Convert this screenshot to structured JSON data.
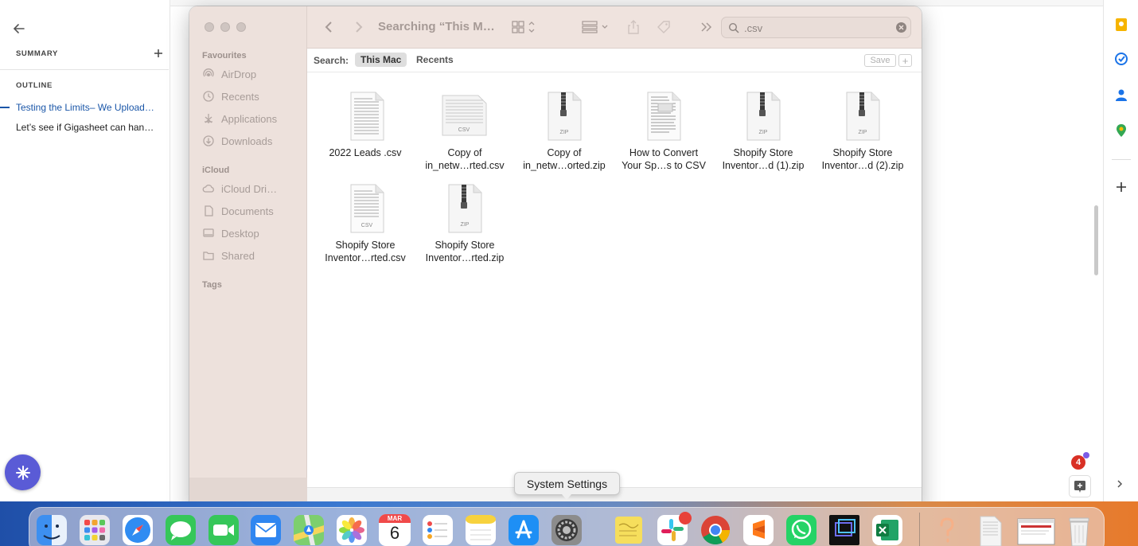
{
  "docs_outline": {
    "summary_label": "SUMMARY",
    "outline_label": "OUTLINE",
    "items": [
      {
        "label": "Testing the Limits– We Upload…",
        "active": true
      },
      {
        "label": "Let’s see if Gigasheet can han…",
        "active": false
      }
    ]
  },
  "finder": {
    "title": "Searching “This M…",
    "search": {
      "value": ".csv"
    },
    "scope": {
      "label": "Search:",
      "options": [
        "This Mac",
        "Recents"
      ],
      "selected": "This Mac",
      "save_label": "Save",
      "add_label": "+"
    },
    "sidebar": {
      "favourites_label": "Favourites",
      "favourites": [
        {
          "label": "AirDrop",
          "icon": "airdrop-icon"
        },
        {
          "label": "Recents",
          "icon": "clock-icon"
        },
        {
          "label": "Applications",
          "icon": "applications-icon"
        },
        {
          "label": "Downloads",
          "icon": "download-icon"
        }
      ],
      "icloud_label": "iCloud",
      "icloud": [
        {
          "label": "iCloud Dri…",
          "icon": "cloud-icon"
        },
        {
          "label": "Documents",
          "icon": "document-icon"
        },
        {
          "label": "Desktop",
          "icon": "desktop-icon"
        },
        {
          "label": "Shared",
          "icon": "shared-folder-icon"
        }
      ],
      "tags_label": "Tags"
    },
    "files": [
      {
        "line1": "2022 Leads .csv",
        "line2": "",
        "type": "csv"
      },
      {
        "line1": "Copy of",
        "line2": "in_netw…rted.csv",
        "type": "csv"
      },
      {
        "line1": "Copy of",
        "line2": "in_netw…orted.zip",
        "type": "zip"
      },
      {
        "line1": "How to Convert",
        "line2": "Your Sp…s to CSV",
        "type": "doc"
      },
      {
        "line1": "Shopify Store",
        "line2": "Inventor…d (1).zip",
        "type": "zip"
      },
      {
        "line1": "Shopify Store",
        "line2": "Inventor…d (2).zip",
        "type": "zip"
      },
      {
        "line1": "Shopify Store",
        "line2": "Inventor…rted.csv",
        "type": "csv"
      },
      {
        "line1": "Shopify Store",
        "line2": "Inventor…rted.zip",
        "type": "zip"
      }
    ],
    "icon_labels": {
      "csv": "CSV",
      "zip": "ZIP"
    }
  },
  "tooltip": {
    "label": "System Settings"
  },
  "notifications": {
    "count": "4"
  },
  "dock": {
    "calendar_month": "MAR",
    "calendar_day": "6",
    "apps": [
      "finder",
      "launchpad",
      "safari",
      "messages",
      "facetime",
      "mail",
      "maps",
      "photos",
      "calendar",
      "reminders",
      "notes",
      "app-store",
      "system-settings",
      "stickies",
      "slack",
      "chrome",
      "sublime-text",
      "whatsapp",
      "screen-recorder",
      "excel",
      "help",
      "csv-file",
      "browser-window",
      "trash"
    ]
  },
  "colors": {
    "finder_sidebar": "#ede1dc",
    "outline_active": "#1a56a8",
    "fab": "#5a5bd6",
    "badge": "#d93025"
  }
}
